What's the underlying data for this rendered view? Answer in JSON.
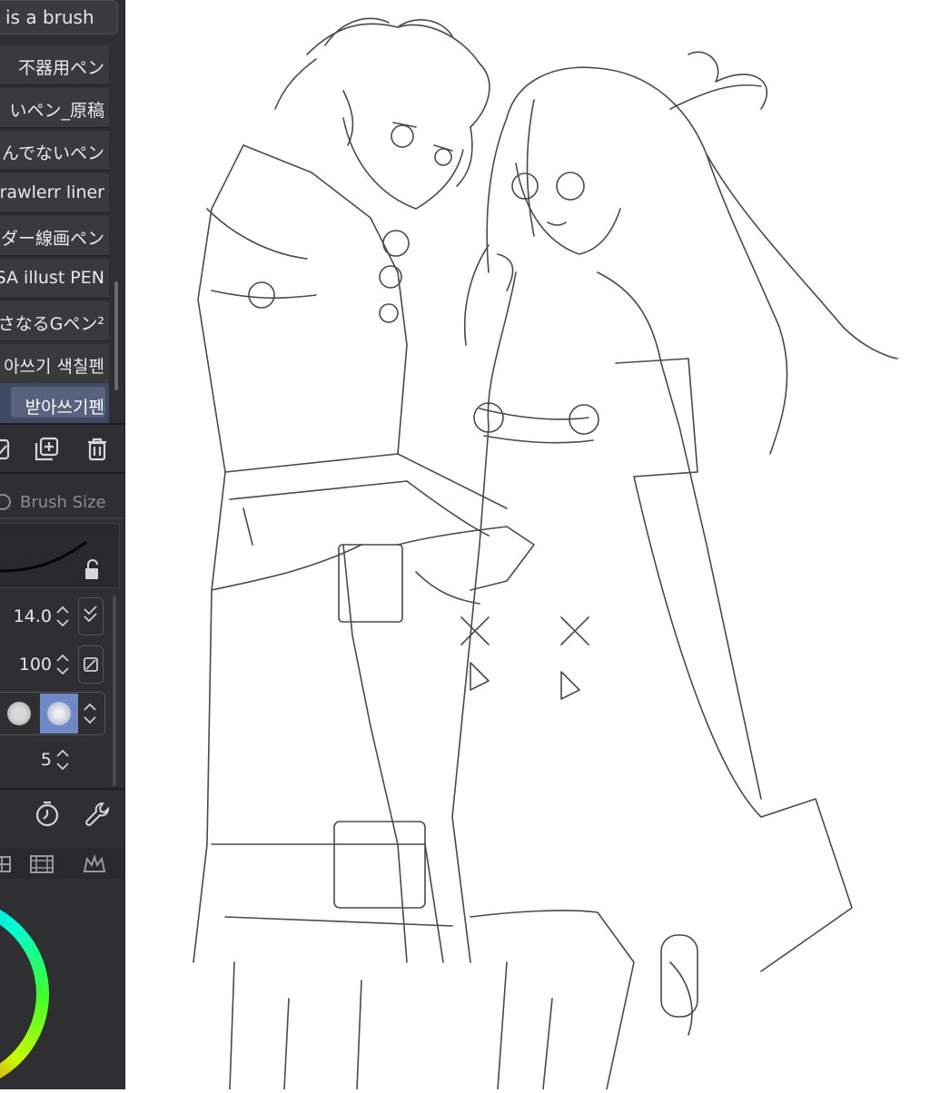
{
  "sub_tool": {
    "title": "is a brush",
    "brushes": [
      {
        "label": "不器用ペン",
        "selected": false
      },
      {
        "label": "いペン_原稿",
        "selected": false
      },
      {
        "label": "んでないペン",
        "selected": false
      },
      {
        "label": "crawlerr liner",
        "selected": false
      },
      {
        "label": "ダー線画ペン",
        "selected": false
      },
      {
        "label": "SA illust PEN",
        "selected": false
      },
      {
        "label": "さなるGペン²",
        "selected": false
      },
      {
        "label": "아쓰기 색칠펜",
        "selected": false
      },
      {
        "label": "받아쓰기펜",
        "selected": true
      }
    ],
    "toolbar_icons": [
      "copy-icon",
      "add-icon",
      "trash-icon"
    ]
  },
  "tool_property": {
    "brush_size_label": "Brush Size",
    "size_value": "14.0",
    "opacity_value": "100",
    "stabilization_value": "5",
    "icons": [
      "lock-icon",
      "pressure-icon",
      "opacity-icon",
      "timer-icon",
      "wrench-icon"
    ]
  },
  "panel_tabs": [
    "grid-icon",
    "film-icon",
    "crown-icon"
  ],
  "colors": {
    "panel_bg": "#2f2f31",
    "selected_item": "#56627e",
    "accent_blue": "#6f88c6"
  },
  "canvas": {
    "content": "line-art-sketch-two-characters"
  }
}
